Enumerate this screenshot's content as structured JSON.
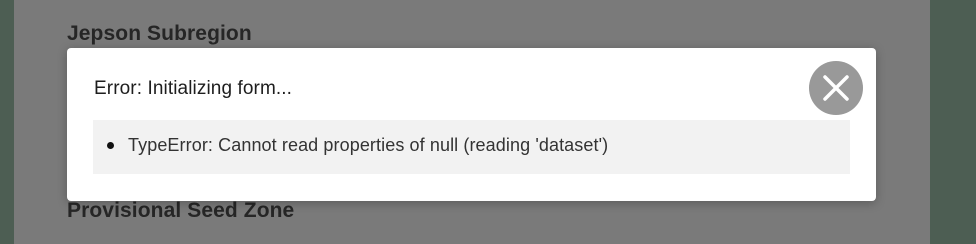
{
  "background": {
    "headings": [
      "Jepson Subregion",
      "Provisional Seed Zone"
    ]
  },
  "dialog": {
    "title": "Error: Initializing form...",
    "errors": [
      "TypeError: Cannot read properties of null (reading 'dataset')"
    ],
    "close_icon": "close-icon"
  },
  "colors": {
    "overlay_panel": "#7a7a7a",
    "page_edge": "#4d5e53",
    "close_button": "#999999",
    "error_box": "#f2f2f2"
  }
}
